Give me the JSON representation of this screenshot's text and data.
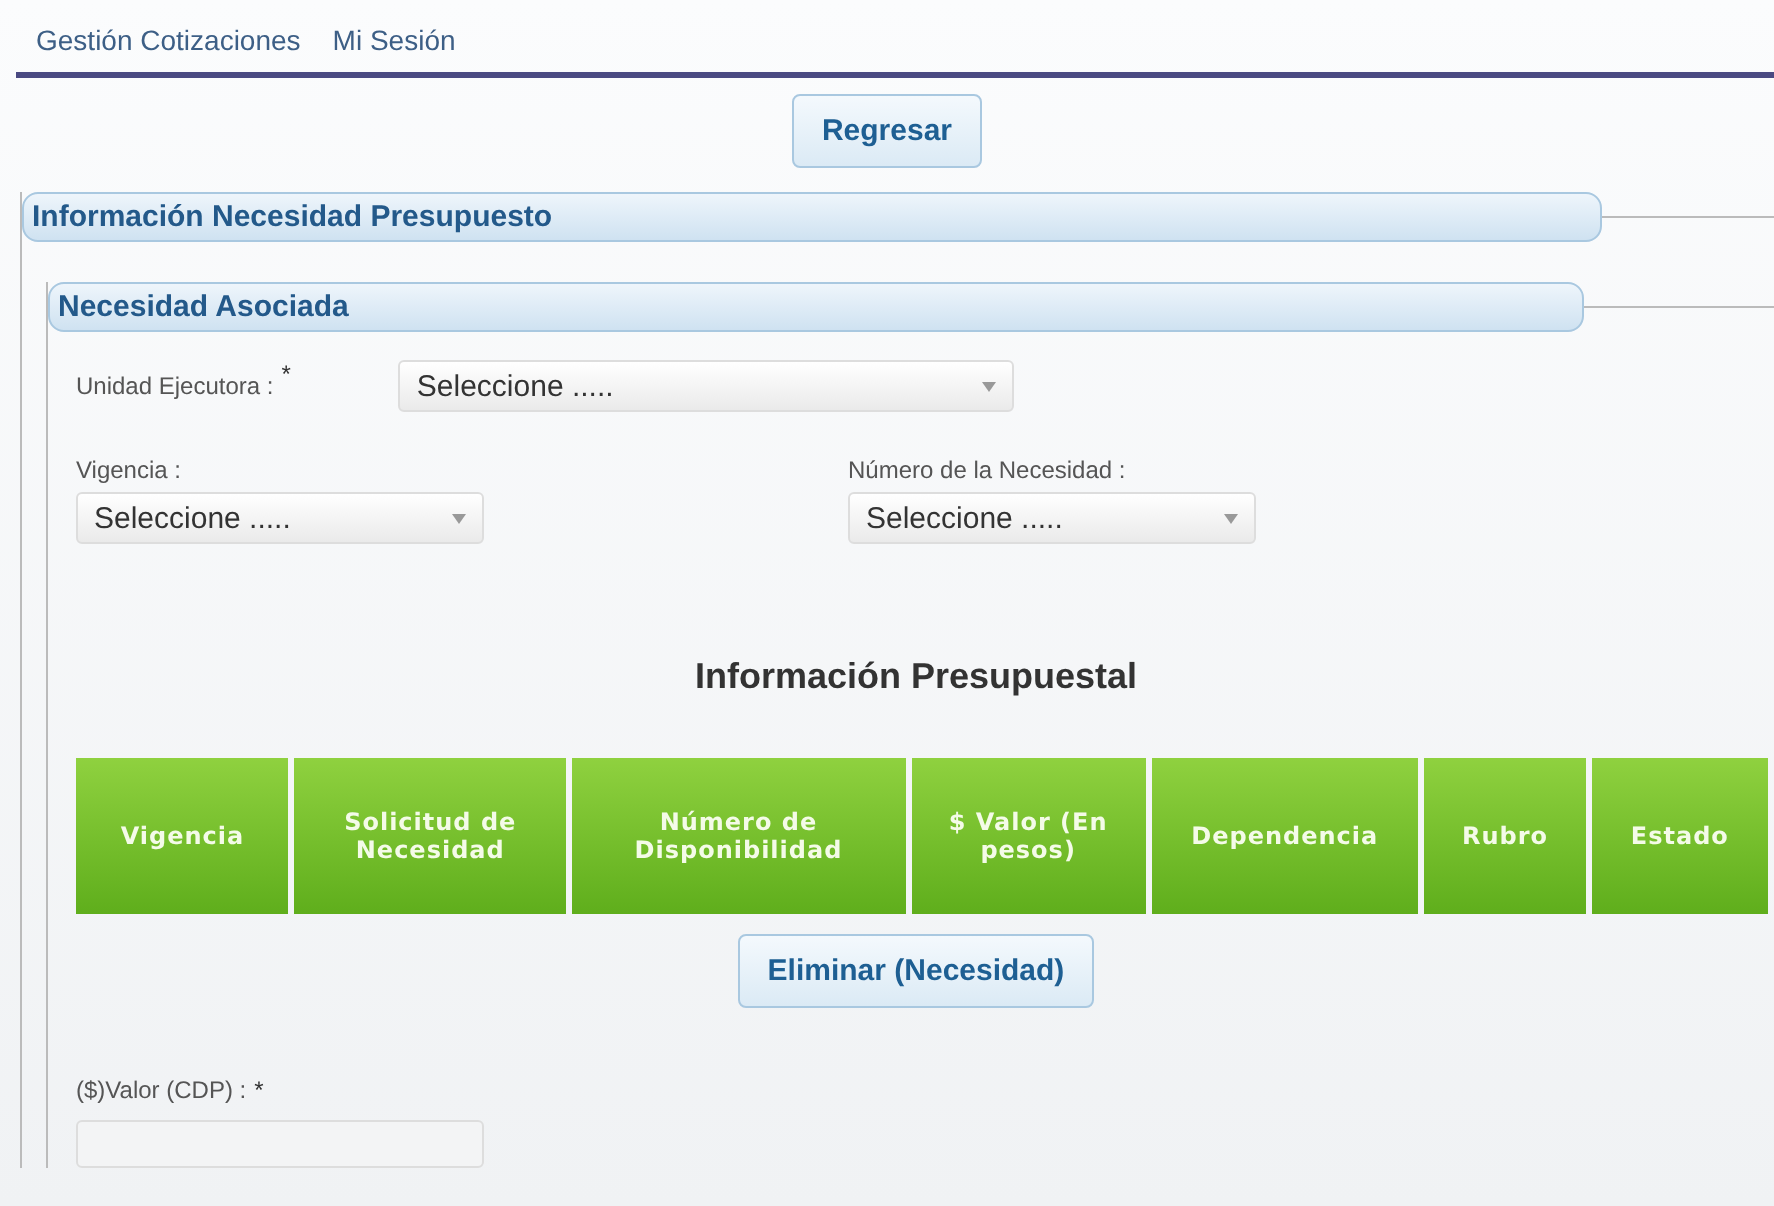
{
  "menu": [
    "Gestión Cotizaciones",
    "Mi Sesión"
  ],
  "back_button": "Regresar",
  "section": {
    "title": "Información Necesidad Presupuesto",
    "subsection": {
      "title": "Necesidad Asociada",
      "unit_field": {
        "label": "Unidad Ejecutora :",
        "required_mark": "*",
        "value": "Seleccione ....."
      },
      "year_field": {
        "label": "Vigencia :",
        "value": "Seleccione ....."
      },
      "need_field": {
        "label": "Número de la Necesidad :",
        "value": "Seleccione ....."
      },
      "table": {
        "title": "Información Presupuestal",
        "columns": [
          "Vigencia",
          "Solicitud de Necesidad",
          "Número de Disponibilidad",
          "$ Valor (En pesos)",
          "Dependencia",
          "Rubro",
          "Estado"
        ]
      },
      "delete_button": "Eliminar (Necesidad)",
      "value_field": {
        "label": "($)Valor (CDP) :",
        "required_mark": "*"
      }
    }
  }
}
